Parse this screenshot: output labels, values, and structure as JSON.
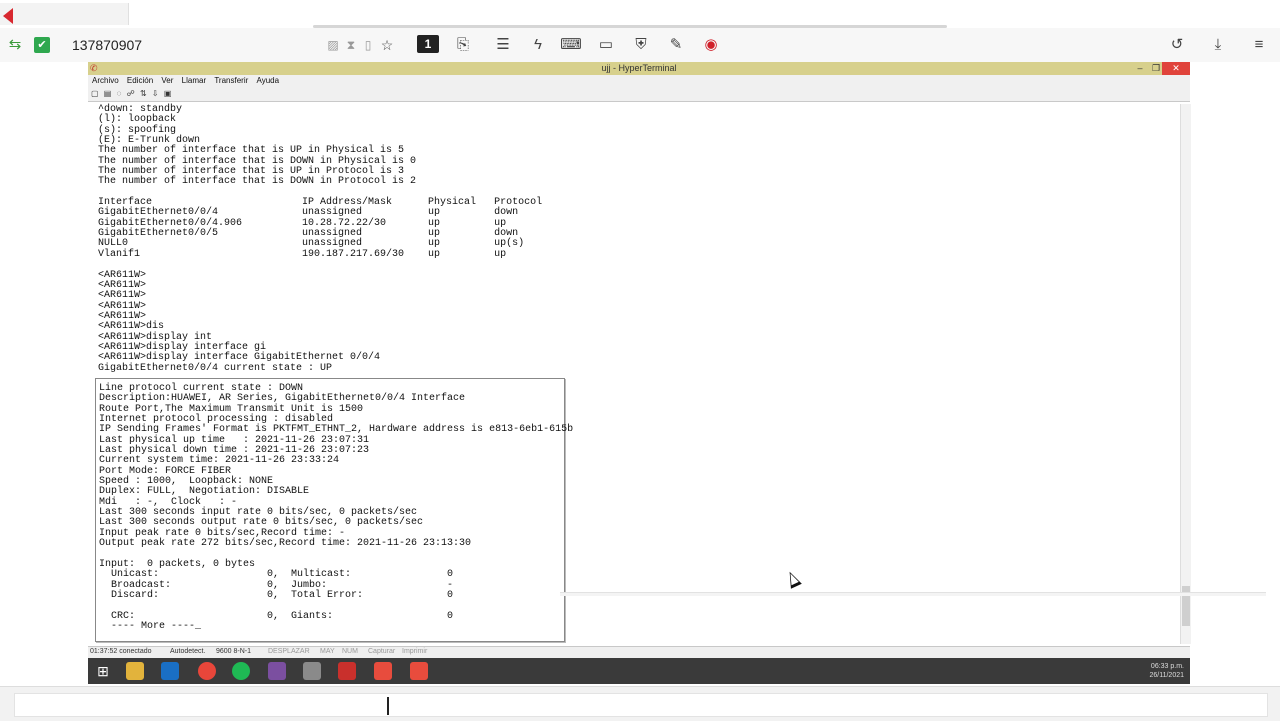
{
  "remote_toolbar": {
    "session_id": "137870907",
    "monitor_number": "1"
  },
  "hyperterminal": {
    "title": "ujj - HyperTerminal",
    "menu": [
      "Archivo",
      "Edición",
      "Ver",
      "Llamar",
      "Transferir",
      "Ayuda"
    ],
    "terminal_lines": [
      "^down: standby",
      "(l): loopback",
      "(s): spoofing",
      "(E): E-Trunk down",
      "The number of interface that is UP in Physical is 5",
      "The number of interface that is DOWN in Physical is 0",
      "The number of interface that is UP in Protocol is 3",
      "The number of interface that is DOWN in Protocol is 2",
      "",
      "Interface                         IP Address/Mask      Physical   Protocol",
      "GigabitEthernet0/0/4              unassigned           up         down",
      "GigabitEthernet0/0/4.906          10.28.72.22/30       up         up",
      "GigabitEthernet0/0/5              unassigned           up         down",
      "NULL0                             unassigned           up         up(s)",
      "Vlanif1                           190.187.217.69/30    up         up",
      "",
      "<AR611W>",
      "<AR611W>",
      "<AR611W>",
      "<AR611W>",
      "<AR611W>",
      "<AR611W>dis",
      "<AR611W>display int",
      "<AR611W>display interface gi",
      "<AR611W>display interface GigabitEthernet 0/0/4",
      "GigabitEthernet0/0/4 current state : UP"
    ],
    "popup_lines": [
      "Line protocol current state : DOWN",
      "Description:HUAWEI, AR Series, GigabitEthernet0/0/4 Interface",
      "Route Port,The Maximum Transmit Unit is 1500",
      "Internet protocol processing : disabled",
      "IP Sending Frames' Format is PKTFMT_ETHNT_2, Hardware address is e813-6eb1-615b",
      "Last physical up time   : 2021-11-26 23:07:31",
      "Last physical down time : 2021-11-26 23:07:23",
      "Current system time: 2021-11-26 23:33:24",
      "Port Mode: FORCE FIBER",
      "Speed : 1000,  Loopback: NONE",
      "Duplex: FULL,  Negotiation: DISABLE",
      "Mdi   : -,  Clock   : -",
      "Last 300 seconds input rate 0 bits/sec, 0 packets/sec",
      "Last 300 seconds output rate 0 bits/sec, 0 packets/sec",
      "Input peak rate 0 bits/sec,Record time: -",
      "Output peak rate 272 bits/sec,Record time: 2021-11-26 23:13:30",
      "",
      "Input:  0 packets, 0 bytes",
      "  Unicast:                  0,  Multicast:                0",
      "  Broadcast:                0,  Jumbo:                    -",
      "  Discard:                  0,  Total Error:              0",
      "",
      "  CRC:                      0,  Giants:                   0",
      "  ---- More ----_"
    ],
    "status_bar": {
      "connected": "01:37:52 conectado",
      "detect": "Autodetect.",
      "settings": "9600 8-N-1",
      "scroll": "DESPLAZAR",
      "caps": "MAY",
      "num": "NUM",
      "capture": "Capturar",
      "print": "Imprimir"
    }
  },
  "taskbar": {
    "clock_time": "06:33 p.m.",
    "clock_date": "26/11/2021"
  }
}
